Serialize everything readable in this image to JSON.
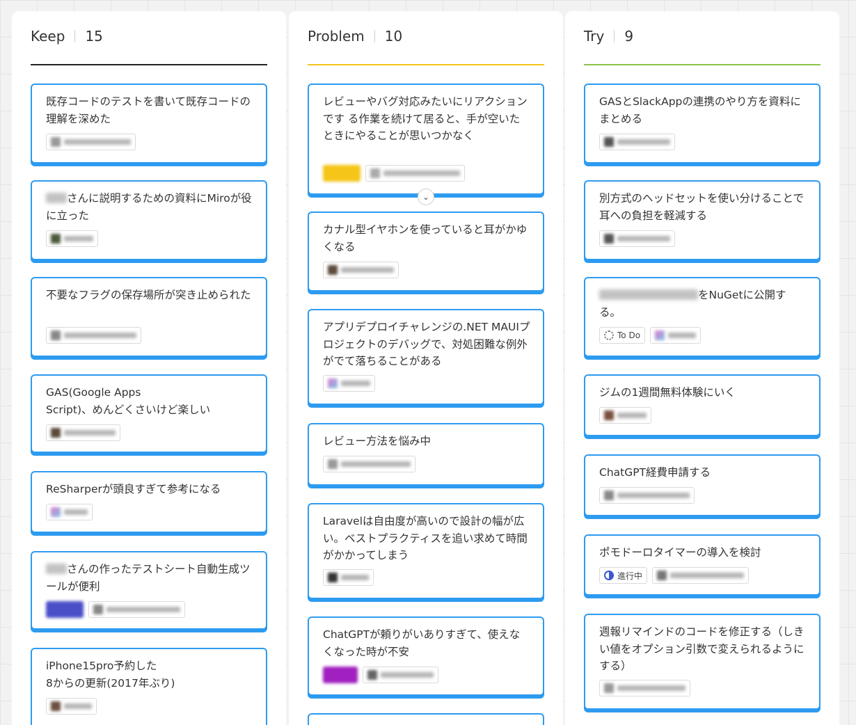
{
  "columns": {
    "keep": {
      "title": "Keep",
      "count": "15",
      "accent": "#222222",
      "cards": [
        {
          "text": "既存コードのテストを書いて既存コードの理解を深めた"
        },
        {
          "text_prefix": "",
          "text": "さんに説明するための資料にMiroが役に立った"
        },
        {
          "text": "不要なフラグの保存場所が突き止められた"
        },
        {
          "text": "GAS(Google Apps\nScript)、めんどくさいけど楽しい"
        },
        {
          "text": "ReSharperが頭良すぎて参考になる"
        },
        {
          "text": "さんの作ったテストシート自動生成ツールが便利"
        },
        {
          "text": "iPhone15pro予約した\n8からの更新(2017年ぶり)"
        }
      ]
    },
    "problem": {
      "title": "Problem",
      "count": "10",
      "accent": "#f5c518",
      "cards": [
        {
          "text": "レビューやバグ対応みたいにリアクションです る作業を続けて居ると、手が空いたときにやることが思いつかなく"
        },
        {
          "text": "カナル型イヤホンを使っていると耳がかゆくなる"
        },
        {
          "text": "アプリデプロイチャレンジの.NET MAUIプロジェクトのデバッグで、対処困難な例外がでて落ちることがある"
        },
        {
          "text": "レビュー方法を悩み中"
        },
        {
          "text": "Laravelは自由度が高いので設計の幅が広い。ベストプラクティスを追い求めて時間がかかってしまう"
        },
        {
          "text": "ChatGPTが頼りがいありすぎて、使えなくなった時が不安"
        }
      ]
    },
    "try": {
      "title": "Try",
      "count": "9",
      "accent": "#8bc34a",
      "cards": [
        {
          "text": "GASとSlackAppの連携のやり方を資料にまとめる"
        },
        {
          "text": "別方式のヘッドセットを使い分けることで耳への負担を軽減する"
        },
        {
          "text": "をNuGetに公開する。",
          "status": "To Do"
        },
        {
          "text": "ジムの1週間無料体験にいく"
        },
        {
          "text": "ChatGPT経費申請する"
        },
        {
          "text": "ポモドーロタイマーの導入を検討",
          "status": "進行中"
        },
        {
          "text": "週報リマインドのコードを修正する（しきい値をオプション引数で変えられるようにする）"
        }
      ]
    }
  },
  "colors": {
    "card_border": "#2d9bf0",
    "in_progress": "#3a56d4",
    "tag_yellow": "#f5c518",
    "tag_indigo": "#4a4fc8",
    "tag_purple": "#a020c0"
  },
  "icons": {
    "expand": "chevron-down-icon",
    "todo": "dotted-circle-icon",
    "in_progress": "half-circle-icon"
  }
}
